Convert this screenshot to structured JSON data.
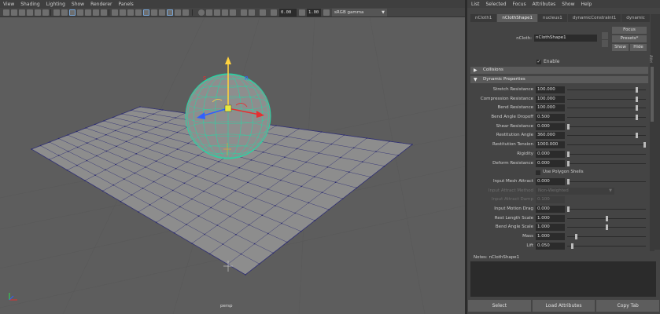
{
  "viewport": {
    "menu": [
      "View",
      "Shading",
      "Lighting",
      "Show",
      "Renderer",
      "Panels"
    ],
    "toolbar": {
      "exposure": "0.00",
      "gamma": "1.00",
      "color_space": "sRGB gamma"
    },
    "camera_label": "persp"
  },
  "attribute_editor": {
    "menu": [
      "List",
      "Selected",
      "Focus",
      "Attributes",
      "Show",
      "Help"
    ],
    "tabs": [
      "nCloth1",
      "nClothShape1",
      "nucleus1",
      "dynamicConstraint1",
      "dynamic"
    ],
    "active_tab_index": 1,
    "side_labels": [
      "Attribute Editor",
      "Tool"
    ],
    "node_label": "nCloth:",
    "node_name": "nClothShape1",
    "buttons": {
      "focus": "Focus",
      "presets": "Presets*",
      "show": "Show",
      "hide": "Hide"
    },
    "enable_label": "Enable",
    "enable_checked": true,
    "sections": {
      "collisions": "Collisions",
      "dynamic_properties": "Dynamic Properties"
    },
    "attributes": [
      {
        "label": "Stretch Resistance",
        "value": "100.000",
        "slider": 0.9
      },
      {
        "label": "Compression Resistance",
        "value": "100.000",
        "slider": 0.9
      },
      {
        "label": "Bend Resistance",
        "value": "100.000",
        "slider": 0.9
      },
      {
        "label": "Bend Angle Dropoff",
        "value": "0.500",
        "slider": 0.9
      },
      {
        "label": "Shear Resistance",
        "value": "0.000",
        "slider": 0.0
      },
      {
        "label": "Restitution Angle",
        "value": "360.000",
        "slider": 0.9
      },
      {
        "label": "Restitution Tension",
        "value": "1000.000",
        "slider": 1.0
      },
      {
        "label": "Rigidity",
        "value": "0.000",
        "slider": 0.0
      },
      {
        "label": "Deform Resistance",
        "value": "0.000",
        "slider": 0.0
      },
      {
        "label": "Use Polygon Shells",
        "kind": "check"
      },
      {
        "label": "Input Mesh Attract",
        "value": "0.000",
        "slider": 0.0
      },
      {
        "label": "Input Attract Method",
        "value": "Non-Weighted",
        "kind": "combo",
        "dim": true
      },
      {
        "label": "Input Attract Damp",
        "value": "0.100",
        "kind": "text",
        "dim": true
      },
      {
        "label": "Input Motion Drag",
        "value": "0.000",
        "slider": 0.0
      },
      {
        "label": "Rest Length Scale",
        "value": "1.000",
        "slider": 0.5
      },
      {
        "label": "Bend Angle Scale",
        "value": "1.000",
        "slider": 0.5
      },
      {
        "label": "Mass",
        "value": "1.000",
        "slider": 0.1
      },
      {
        "label": "Lift",
        "value": "0.050",
        "slider": 0.05
      }
    ],
    "notes_label": "Notes:  nClothShape1",
    "bottom_buttons": [
      "Select",
      "Load Attributes",
      "Copy Tab"
    ]
  }
}
